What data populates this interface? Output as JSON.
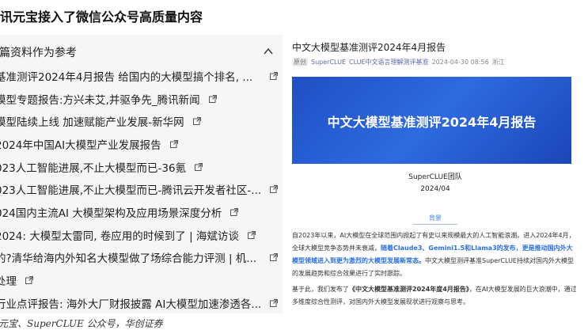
{
  "page_title": "讯元宝接入了微信公众号高质量内容",
  "refs_section": {
    "title": "篇资料作为参考"
  },
  "refs": [
    {
      "text": "基准测评2024年4月报告 给国内的大模型搞个排名, ..."
    },
    {
      "text": "模型专题报告:方兴未艾,并驱争先_腾讯新闻"
    },
    {
      "text": "模型陆续上线 加速赋能产业发展-新华网"
    },
    {
      "text": "2024年中国AI大模型产业发展报告"
    },
    {
      "text": "023人工智能进展,不止大模型而已-36氪"
    },
    {
      "text": "023人工智能进展,不止大模型而已-腾讯云开发者社区-..."
    },
    {
      "text": "024国内主流AI 大模型架构及应用场景深度分析"
    },
    {
      "text": "2024: 大模型太雷同, 卷应用的时候到了 | 海斌访谈"
    },
    {
      "text": "的?清华给海内外知名大模型做了场综合能力评测 | 机..."
    },
    {
      "text": "处理"
    },
    {
      "text": "行业点评报告: 海外大厂财报披露 AI大模型加速渗透各..."
    }
  ],
  "caption": "元宝、SuperCLUE 公众号，华创证券",
  "article": {
    "title": "中文大模型基准测评2024年4月报告",
    "tag": "原创",
    "author": "SuperCLUE",
    "account": "CLUE中文语言理解测评基准",
    "date": "2024-04-30 08:56",
    "location": "浙江",
    "banner_text": "中文大模型基准测评2024年4月报告",
    "team": "SuperCLUE团队",
    "report_date": "2024/04",
    "section_label": "背景",
    "para1_a": "自2023年以来，AI大模型在全球范围内掀起了有史以来规模最大的人工智能浪潮。进入2024年4月，全球大模型竞争态势并未衰减，",
    "para1_hl": "随着Claude3、Gemini1.5和Llama3的发布，更是推动国内外大模型领域进入到更为激烈的大模型发展新常态。",
    "para1_b": "中文大模型测评基准SuperCLUE持续对国内外大模型的发展趋势和综合效果进行了实时跟踪。",
    "para2_a": "基于此，我们发布了",
    "para2_bold": "《中文大模型基准测评2024年度4月报告》",
    "para2_b": "，在AI大模型发展的巨大浪潮中，通过多维度综合性测评，对国内外大模型发展现状进行观察与思考。"
  }
}
